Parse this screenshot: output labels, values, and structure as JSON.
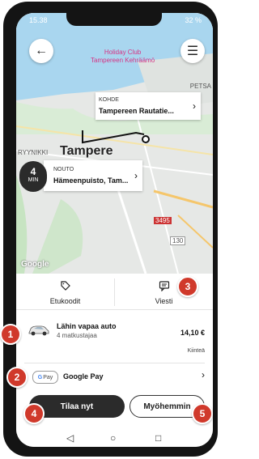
{
  "status_bar": {
    "time": "15.38",
    "battery": "32 %"
  },
  "map": {
    "poi_line1": "Holiday Club",
    "poi_line2": "Tampereen Kehräämö",
    "city": "Tampere",
    "label_petsamo": "PETSA",
    "label_ryynikki": "RYYNIKKI",
    "road_3495": "3495",
    "road_130": "130",
    "watermark": "Google"
  },
  "destination": {
    "label": "KOHDE",
    "name": "Tampereen Rautatie..."
  },
  "pickup": {
    "minutes": "4",
    "min_label": "MIN",
    "label": "NOUTO",
    "name": "Hämeenpuisto, Tam..."
  },
  "tabs": {
    "promo_label": "Etukoodit",
    "message_label": "Viesti"
  },
  "ride": {
    "title": "Lähin vapaa auto",
    "subtitle": "4 matkustajaa",
    "price": "14,10 €",
    "price_type": "Kiinteä"
  },
  "payment": {
    "badge_letter": "G",
    "badge_text": "Pay",
    "label": "Google Pay"
  },
  "actions": {
    "order": "Tilaa nyt",
    "later": "Myöhemmin"
  },
  "markers": [
    "1",
    "2",
    "3",
    "4",
    "5"
  ],
  "colors": {
    "marker": "#d0392b",
    "dark_button": "#2b2b2b",
    "poi": "#d63384"
  }
}
